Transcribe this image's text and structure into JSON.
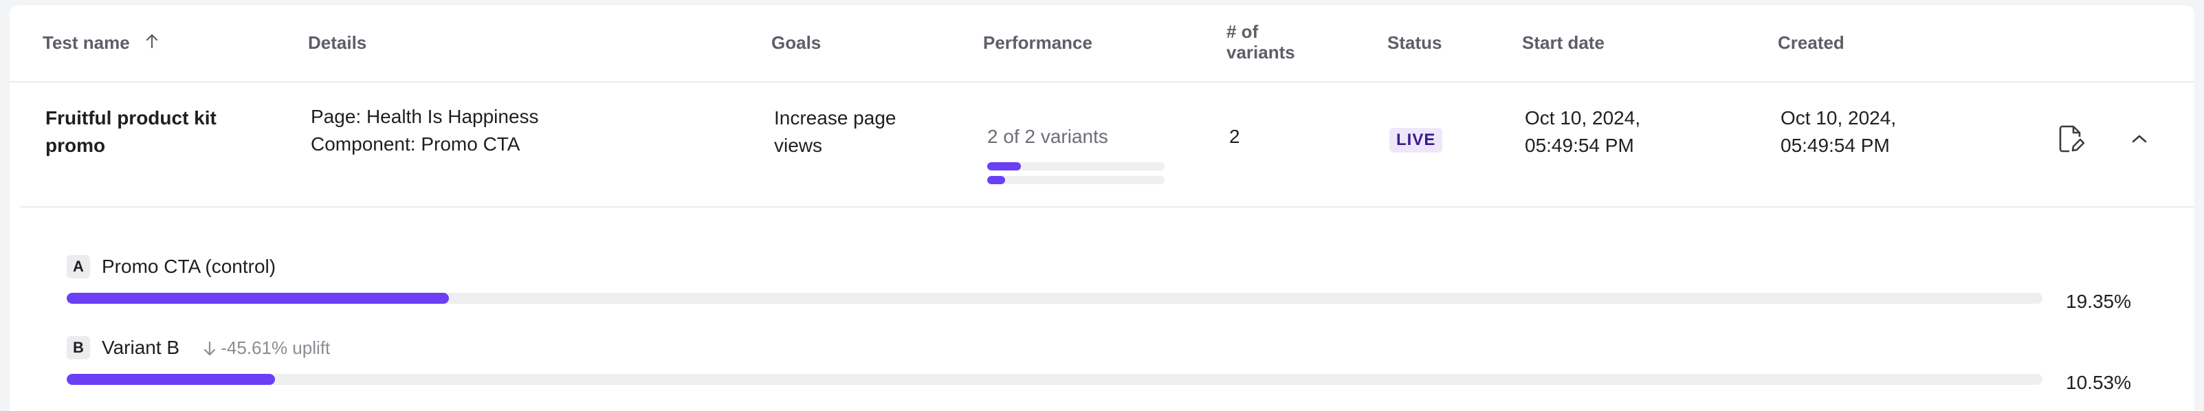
{
  "columns": {
    "test_name": "Test name",
    "details": "Details",
    "goals": "Goals",
    "performance": "Performance",
    "num_variants_line1": "# of",
    "num_variants_line2": "variants",
    "status": "Status",
    "start_date": "Start date",
    "created": "Created"
  },
  "row": {
    "name_line1": "Fruitful product kit",
    "name_line2": "promo",
    "details_page": "Page: Health Is Happiness",
    "details_component": "Component: Promo CTA",
    "goals_line1": "Increase page",
    "goals_line2": "views",
    "performance_text": "2 of 2 variants",
    "performance_bars": [
      0.19,
      0.1
    ],
    "variants_count": "2",
    "status": "LIVE",
    "start_date_line1": "Oct 10, 2024,",
    "start_date_line2": "05:49:54 PM",
    "created_line1": "Oct 10, 2024,",
    "created_line2": "05:49:54 PM"
  },
  "variants": [
    {
      "letter": "A",
      "name": "Promo CTA (control)",
      "uplift": "",
      "percent": "19.35%",
      "fill": 0.1935
    },
    {
      "letter": "B",
      "name": "Variant B",
      "uplift": "-45.61% uplift",
      "percent": "10.53%",
      "fill": 0.1053
    }
  ],
  "icons": {
    "edit": "edit-document-icon",
    "collapse": "chevron-up-icon",
    "sort": "arrow-up-icon",
    "uplift": "arrow-down-icon"
  },
  "colors": {
    "accent": "#6a3ff5",
    "badge_bg": "#ede7fc",
    "badge_text": "#3a1a8c"
  }
}
